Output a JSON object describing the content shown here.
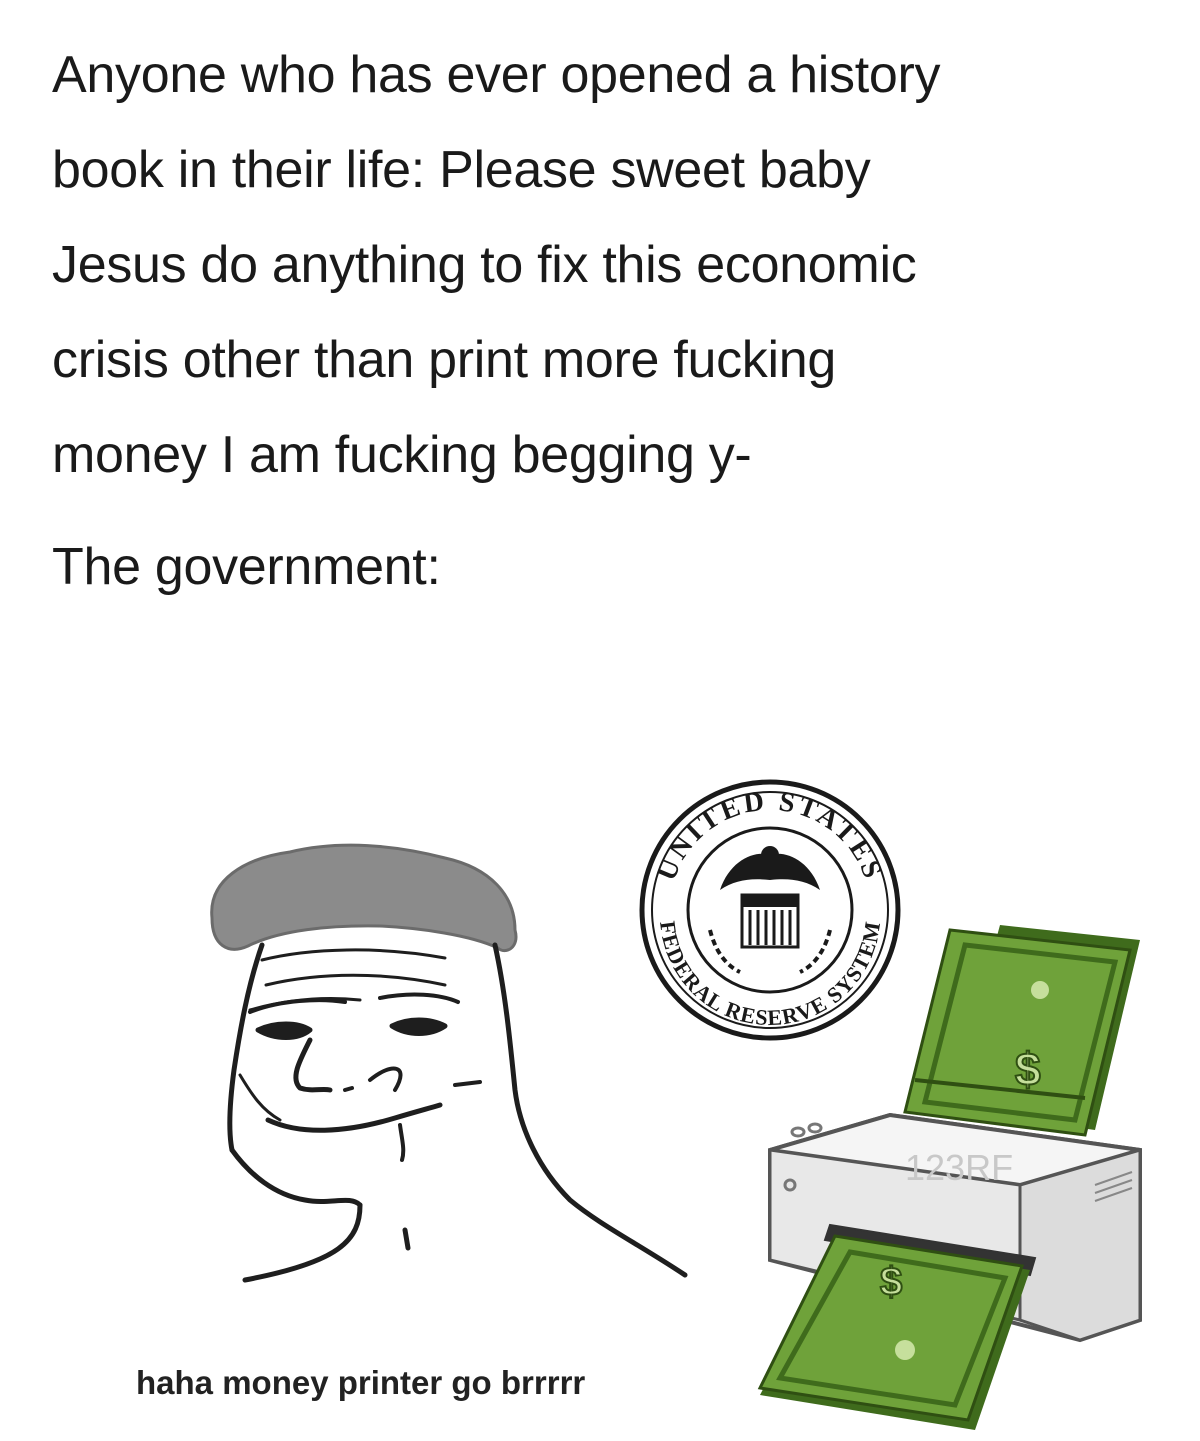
{
  "post": {
    "lines": [
      "Anyone who has ever opened a history",
      "book in their life: Please sweet baby",
      "Jesus do anything to fix this economic",
      "crisis other than print more fucking",
      "money I am fucking begging y-"
    ],
    "subject": "The government:"
  },
  "illustration": {
    "seal_text_top": "UNITED STATES",
    "seal_text_bottom": "FEDERAL RESERVE SYSTEM",
    "printer_watermark": "123RF",
    "caption": "haha money printer go brrrrr",
    "colors": {
      "money_green": "#6fa23a",
      "money_dark": "#3f6b1c",
      "hair_gray": "#8a8a8a",
      "printer_light": "#ececec"
    }
  }
}
